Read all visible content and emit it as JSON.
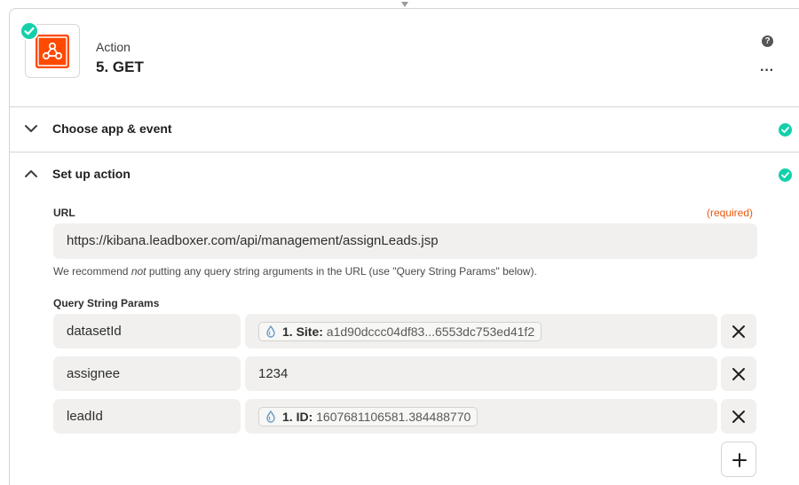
{
  "header": {
    "kind_label": "Action",
    "title": "5. GET",
    "app_icon": "webhook-icon",
    "help_glyph": "?",
    "more_glyph": "···"
  },
  "sections": [
    {
      "label": "Choose app & event",
      "expanded": false,
      "complete": true
    },
    {
      "label": "Set up action",
      "expanded": true,
      "complete": true
    }
  ],
  "form": {
    "url": {
      "label": "URL",
      "required_text": "(required)",
      "value": "https://kibana.leadboxer.com/api/management/assignLeads.jsp"
    },
    "hint": {
      "before": "We recommend ",
      "emphasis": "not",
      "after": " putting any query string arguments in the URL (use \"Query String Params\" below)."
    },
    "query_params_label": "Query String Params",
    "params": [
      {
        "key": "datasetId",
        "value_type": "pill",
        "pill_label": "1. Site:",
        "pill_value": "a1d90dccc04df83...6553dc753ed41f2"
      },
      {
        "key": "assignee",
        "value_type": "text",
        "value": "1234"
      },
      {
        "key": "leadId",
        "value_type": "pill",
        "pill_label": "1. ID:",
        "pill_value": "1607681106581.384488770"
      }
    ]
  },
  "colors": {
    "accent_green": "#13d0ab",
    "brand_orange": "#ff4a00",
    "required_orange": "#e8590c",
    "field_bg": "#f1f0ee"
  }
}
